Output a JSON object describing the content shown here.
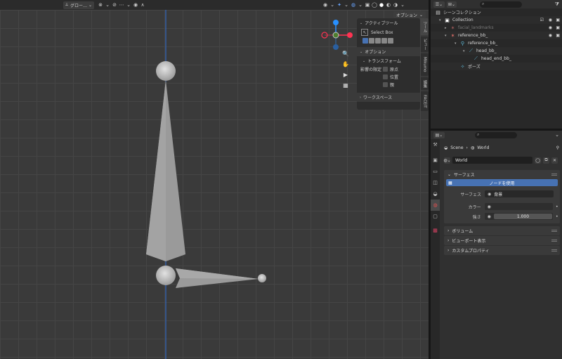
{
  "viewport": {
    "header": {
      "transform_orientation": "グロー…",
      "options_label": "オプション"
    },
    "gizmo_axes": {
      "x_color": "#ff3352",
      "y_color": "#8bdc00",
      "z_color": "#2890ff",
      "y_neg_color": "#4d7d2e"
    },
    "bone_color": "#9a9a9a",
    "axis_line_color": "#2f6fd6"
  },
  "npanel": {
    "active_tool_header": "アクティブツール",
    "active_tool_name": "Select Box",
    "options_header": "オプション",
    "transform_header": "トランスフォーム",
    "affect_only_label": "影響の限定",
    "affect_options": [
      "原点",
      "位置",
      "親"
    ],
    "workspace_header": "ワークスペース",
    "tabs": [
      "ツール",
      "ビュー",
      "Mikumo",
      "編集",
      "FACEIT"
    ]
  },
  "outliner": {
    "root_label": "シーンコレクション",
    "rows": [
      {
        "label": "Collection",
        "icon": "collection-icon"
      },
      {
        "label": "facial_landmarks",
        "icon": "armature-icon",
        "disabled": true
      },
      {
        "label": "reference_bb_",
        "icon": "armature-icon"
      },
      {
        "label": "reference_bb_",
        "icon": "armature-data-icon"
      },
      {
        "label": "head_bb_",
        "icon": "bone-icon"
      },
      {
        "label": "head_end_bb_",
        "icon": "bone-icon"
      },
      {
        "label": "ポーズ",
        "icon": "pose-icon"
      }
    ]
  },
  "properties": {
    "breadcrumb_scene": "Scene",
    "breadcrumb_world": "World",
    "world_name": "World",
    "surface_panel": "サーフェス",
    "use_nodes_button": "ノードを使用",
    "surface_label": "サーフェス",
    "surface_value": "背景",
    "color_label": "カラー",
    "strength_label": "強さ",
    "strength_value": "1.000",
    "volume_panel": "ボリューム",
    "viewport_display_panel": "ビューポート表示",
    "custom_props_panel": "カスタムプロパティ"
  }
}
